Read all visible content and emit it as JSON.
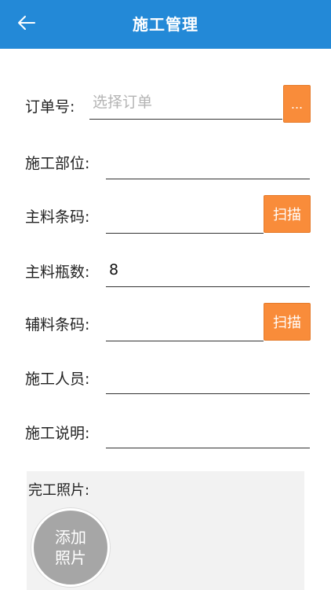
{
  "header": {
    "title": "施工管理",
    "back_icon": "arrow-left-icon",
    "bg_color": "#2389d7"
  },
  "form": {
    "order": {
      "label": "订单号:",
      "value": "",
      "placeholder": "选择订单",
      "picker_label": "..."
    },
    "position": {
      "label": "施工部位:",
      "value": ""
    },
    "main_barcode": {
      "label": "主料条码:",
      "value": "",
      "scan_label": "扫描"
    },
    "main_bottles": {
      "label": "主料瓶数:",
      "value": "8"
    },
    "aux_barcode": {
      "label": "辅料条码:",
      "value": "",
      "scan_label": "扫描"
    },
    "workers": {
      "label": "施工人员:",
      "value": ""
    },
    "description": {
      "label": "施工说明:",
      "value": ""
    }
  },
  "photos": {
    "label": "完工照片:",
    "add_line1": "添加",
    "add_line2": "照片"
  },
  "colors": {
    "accent_orange": "#f98c3a"
  }
}
